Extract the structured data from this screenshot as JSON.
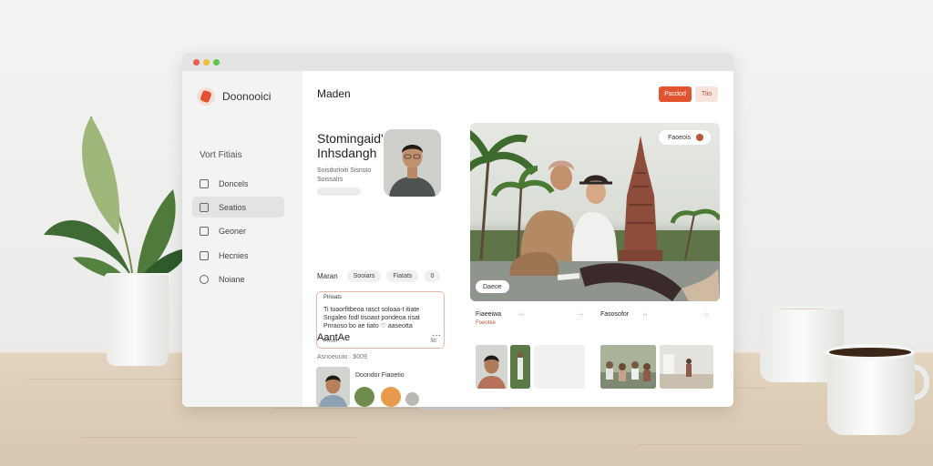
{
  "sidebar": {
    "brand": "Doonooici",
    "nav_header": "Vort Fitiais",
    "items": [
      {
        "label": "Doncels",
        "icon": "calendar-icon"
      },
      {
        "label": "Seatios",
        "icon": "document-icon"
      },
      {
        "label": "Geoner",
        "icon": "chat-icon"
      },
      {
        "label": "Hecnies",
        "icon": "image-icon"
      },
      {
        "label": "Noiane",
        "icon": "clock-icon"
      }
    ]
  },
  "header": {
    "title": "Maden",
    "primary_button": "Pacdod",
    "secondary_button": "Tlio"
  },
  "profile": {
    "name": "Stomingaid' Inhsdangh",
    "subtitle": "Soisdurloiti Sisnsto Soissalrs",
    "photo_alt": "portrait"
  },
  "chips": {
    "label": "Maran",
    "items": [
      "Sooiars",
      "Fiatats",
      "0"
    ]
  },
  "text_card": {
    "title": "Pinoats",
    "body": "Ti tuaorfitbeoa rasct soloaa-t itiate Sngaleo fodl tisoaot pondeoa risat Pnraoso bo ae tiato ♡ aaseotta",
    "footer_left": "Pitsot",
    "footer_right": "$tt"
  },
  "section": {
    "title": "AantAe",
    "more": "···",
    "subtitle": "Asnoeuuio · $009",
    "person_name": "Doondor Fiaoetio"
  },
  "hero": {
    "badge": "Faoeois",
    "tag": "Daeoe"
  },
  "mini_cards": [
    {
      "title": "Fiaeeiwa",
      "subtitle": "Foeotee"
    },
    {
      "title": "Fasosofor",
      "subtitle": ""
    }
  ],
  "colors": {
    "accent": "#e1542f",
    "accent_soft": "#f8e4dd",
    "sidebar_bg": "#f3f3f3"
  }
}
